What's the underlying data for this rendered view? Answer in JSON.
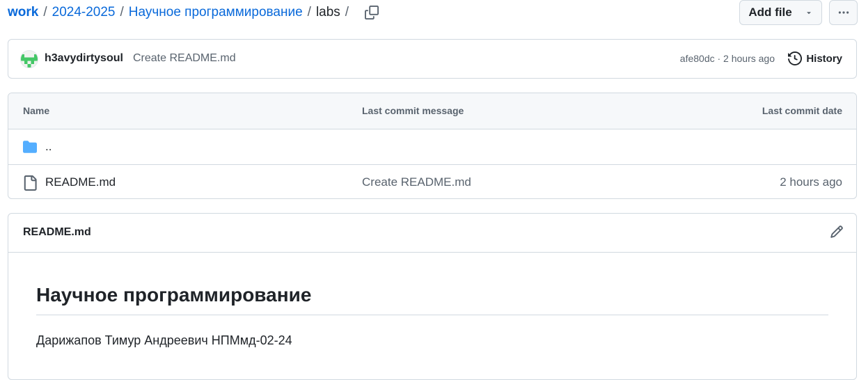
{
  "breadcrumb": {
    "items": [
      "work",
      "2024-2025",
      "Научное программирование",
      "labs"
    ],
    "separator": "/"
  },
  "actions": {
    "add_file_label": "Add file"
  },
  "commit": {
    "author": "h3avydirtysoul",
    "message": "Create README.md",
    "sha_time": "afe80dc · 2 hours ago",
    "history_label": "History"
  },
  "file_table": {
    "headers": {
      "name": "Name",
      "message": "Last commit message",
      "date": "Last commit date"
    },
    "rows": [
      {
        "name": "..",
        "message": "",
        "date": "",
        "icon": "folder-icon"
      },
      {
        "name": "README.md",
        "message": "Create README.md",
        "date": "2 hours ago",
        "icon": "file-icon"
      }
    ]
  },
  "readme": {
    "title": "README.md",
    "heading": "Научное программирование",
    "paragraph": "Дарижапов Тимур Андреевич НПМмд-02-24"
  },
  "colors": {
    "link": "#0969da",
    "muted": "#59636e",
    "border": "#d1d9e0",
    "folder": "#54aeff",
    "avatar": "#44c767"
  }
}
